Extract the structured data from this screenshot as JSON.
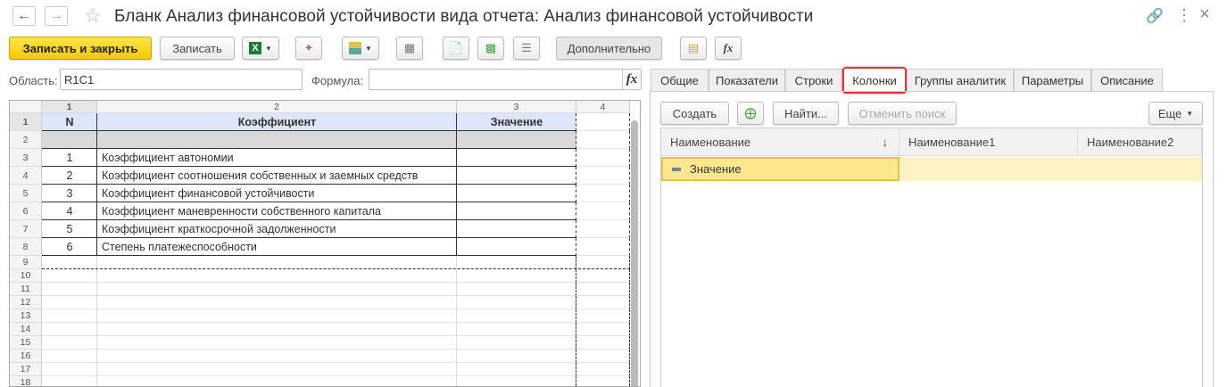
{
  "window": {
    "title": "Бланк Анализ финансовой устойчивости вида отчета: Анализ финансовой устойчивости",
    "back_icon": "arrow-left",
    "forward_icon": "arrow-right",
    "star_icon": "star",
    "link_icon": "link",
    "menu_icon": "more-vertical",
    "close_icon": "close"
  },
  "toolbar": {
    "save_close": "Записать и закрыть",
    "save": "Записать",
    "more": "Дополнительно"
  },
  "fields": {
    "area_label": "Область:",
    "area_value": "R1C1",
    "formula_label": "Формула:",
    "formula_value": "",
    "fx": "fx"
  },
  "sheet": {
    "col_headers": [
      "1",
      "2",
      "3",
      "4"
    ],
    "row_numbers": [
      "1",
      "2",
      "3",
      "4",
      "5",
      "6",
      "7",
      "8",
      "9",
      "10",
      "11",
      "12",
      "13",
      "14",
      "15",
      "16",
      "17",
      "18"
    ],
    "header": {
      "n": "N",
      "coef": "Коэффициент",
      "value": "Значение"
    },
    "rows": [
      {
        "n": "1",
        "name": "Коэффициент автономии"
      },
      {
        "n": "2",
        "name": "Коэффициент соотношения собственных и заемных средств"
      },
      {
        "n": "3",
        "name": "Коэффициент финансовой устойчивости"
      },
      {
        "n": "4",
        "name": "Коэффициент маневренности собственного капитала"
      },
      {
        "n": "5",
        "name": "Коэффициент краткосрочной задолженности"
      },
      {
        "n": "6",
        "name": "Степень платежеспособности"
      }
    ]
  },
  "tabs": [
    {
      "label": "Общие"
    },
    {
      "label": "Показатели"
    },
    {
      "label": "Строки"
    },
    {
      "label": "Колонки",
      "active": true
    },
    {
      "label": "Группы аналитик"
    },
    {
      "label": "Параметры"
    },
    {
      "label": "Описание"
    }
  ],
  "panel": {
    "create": "Создать",
    "find": "Найти...",
    "cancel_search": "Отменить поиск",
    "more": "Еще",
    "columns": [
      "Наименование",
      "Наименование1",
      "Наименование2"
    ],
    "sort_icon": "↓",
    "rows": [
      {
        "name": "Значение",
        "name1": "",
        "name2": ""
      }
    ]
  },
  "colors": {
    "accent": "#f5c900",
    "selected_row": "#fbe88e",
    "selected_row_light": "#fdf2c4",
    "active_tab_border": "#d9363e",
    "header_fill": "#dde6fb",
    "gray_row": "#d9d9d9"
  }
}
